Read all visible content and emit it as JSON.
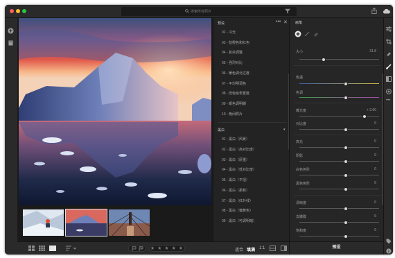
{
  "search": {
    "placeholder": "搜索所有照片"
  },
  "bottom": {
    "fit_label": "适合",
    "fill_label": "填满",
    "ratio_label": "1:1",
    "stars": "★ ★ ★ ★ ★"
  },
  "presets": {
    "title": "预设",
    "groups": [
      {
        "name": "",
        "items": [
          "02 - 冷光",
          "03 - 蓝橙色和红色",
          "04 - 复杂调整",
          "05 - 强烈对比",
          "06 - 暖色调北过度",
          "07 - 平均明调色",
          "08 - 低色级表置度",
          "09 - 暖色调明朗",
          "10 - 晚间照片"
        ]
      },
      {
        "name": "黑白",
        "items": [
          "01 - 黑白（风景）",
          "02 - 黑白（高对比度）",
          "03 - 黑白（厚重）",
          "04 - 黑白（低对比度）",
          "05 - 黑白（平坦）",
          "06 - 黑白（柔和）",
          "07 - 黑白（红外线）",
          "08 - 黑白（偏黄色）",
          "09 - 黑白（可调明暗）"
        ]
      }
    ]
  },
  "panel": {
    "title": "画笔",
    "size_label": "大小",
    "size_value": "31.8",
    "temp_label": "色温",
    "tint_label": "色调",
    "exposure_label": "曝光度",
    "exposure_value": "+ 2.60",
    "contrast_label": "对比度",
    "highlights_label": "高光",
    "shadows_label": "阴影",
    "whites_label": "白色色阶",
    "blacks_label": "黑色色阶",
    "texture_label": "清晰度",
    "dehaze_label": "去朦胧",
    "saturation_label": "饱和度",
    "zero": "0",
    "slider_positions": {
      "size": 0.3,
      "temp": 0.58,
      "tint": 0.58,
      "exposure": 0.82,
      "contrast": 0.58,
      "highlights": 0.58,
      "shadows": 0.58,
      "whites": 0.58,
      "blacks": 0.58,
      "texture": 0.58,
      "dehaze": 0.58,
      "saturation": 0.58
    }
  },
  "preset_button": "预设"
}
